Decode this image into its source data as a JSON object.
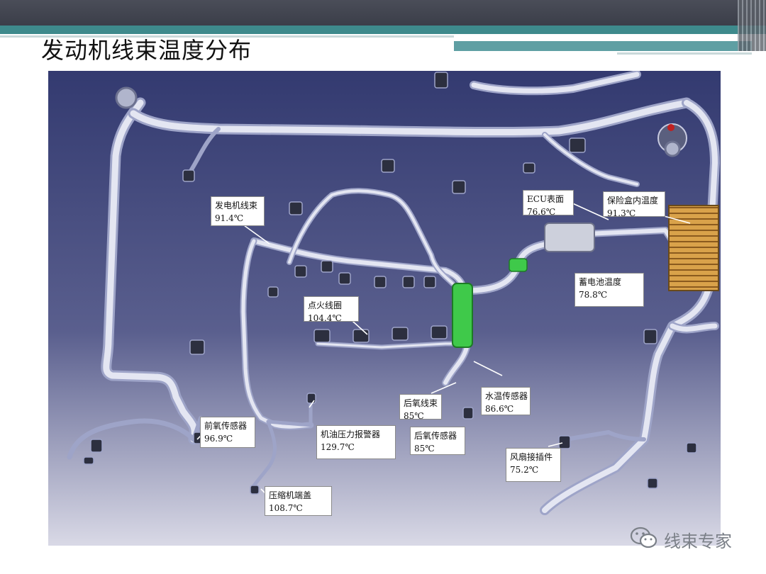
{
  "slide": {
    "title": "发动机线束温度分布"
  },
  "labels": [
    {
      "id": "generator",
      "name": "发电机线束",
      "temp": "91.4℃"
    },
    {
      "id": "ecu",
      "name": "ECU表面",
      "temp": "76.6℃"
    },
    {
      "id": "fusebox",
      "name": "保险盒内温度",
      "temp": "91.3℃"
    },
    {
      "id": "battery",
      "name": "蓄电池温度",
      "temp": "78.8℃"
    },
    {
      "id": "ignition",
      "name": "点火线圈",
      "temp": "104.4℃"
    },
    {
      "id": "rear-o2-harness",
      "name": "后氧线束",
      "temp": "85℃"
    },
    {
      "id": "coolant",
      "name": "水温传感器",
      "temp": "86.6℃"
    },
    {
      "id": "front-o2",
      "name": "前氧传感器",
      "temp": "96.9℃"
    },
    {
      "id": "oil-pressure",
      "name": "机油压力报警器",
      "temp": "129.7℃"
    },
    {
      "id": "rear-o2-sensor",
      "name": "后氧传感器",
      "temp": "85℃"
    },
    {
      "id": "fan",
      "name": "风扇接插件",
      "temp": "75.2℃"
    },
    {
      "id": "compressor",
      "name": "压缩机端盖",
      "temp": "108.7℃"
    }
  ],
  "brand": {
    "text": "线束专家",
    "icon": "wechat-icon"
  }
}
